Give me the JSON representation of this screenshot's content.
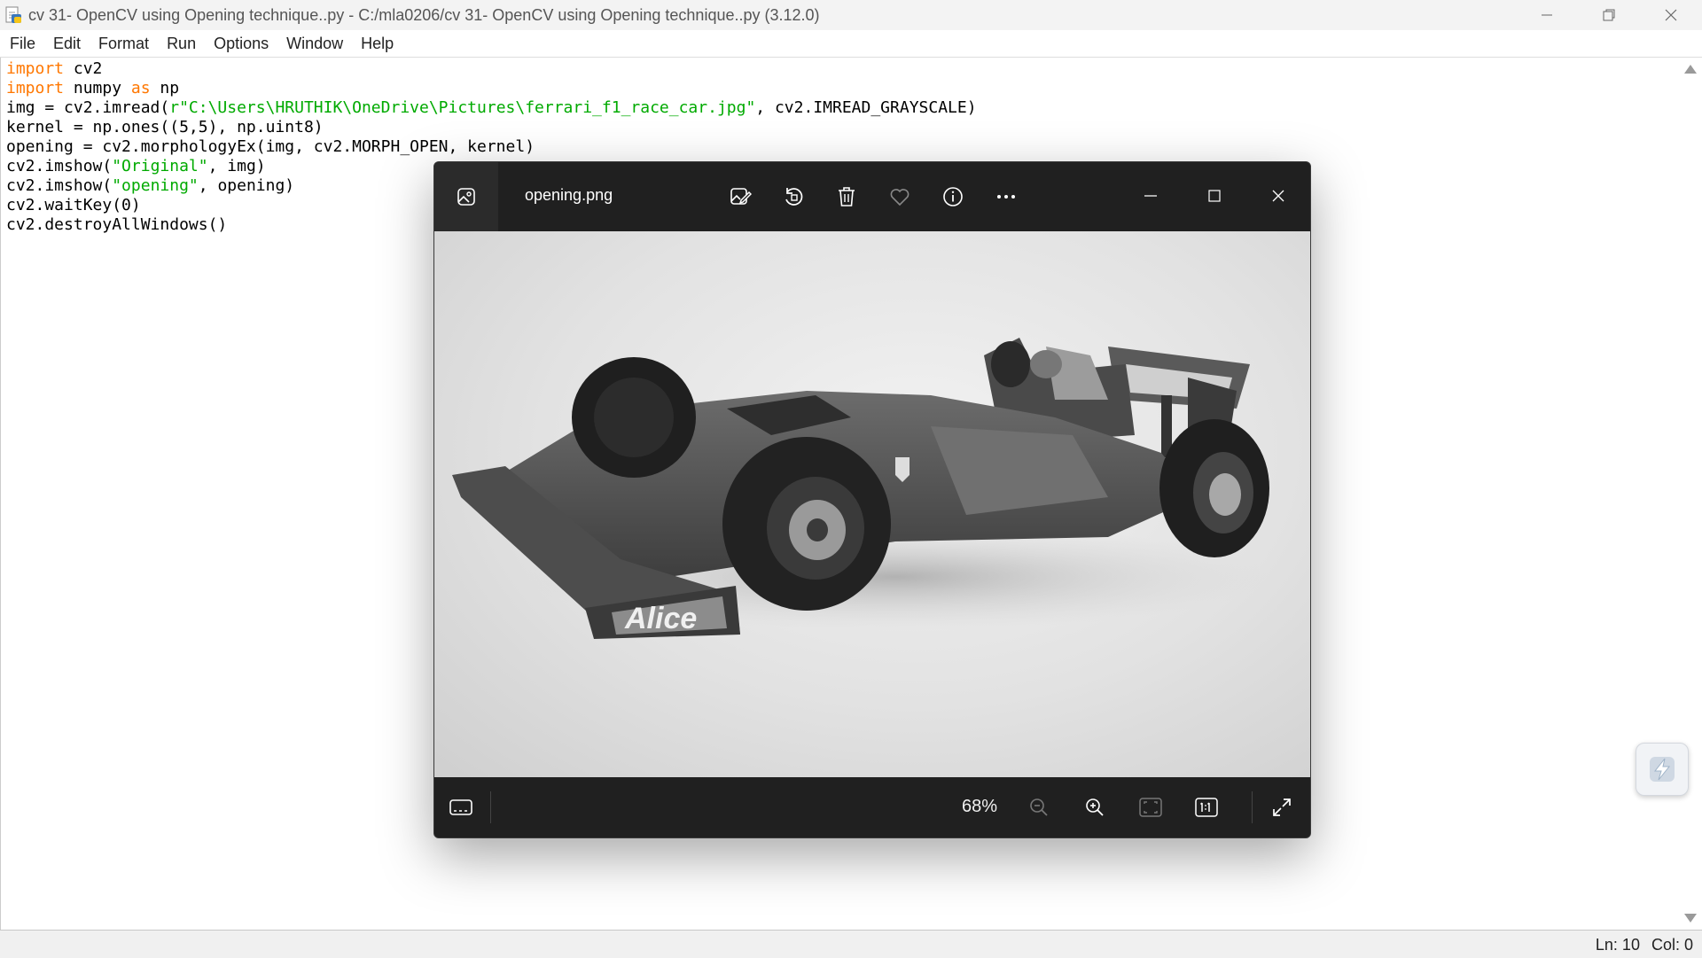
{
  "window": {
    "title": "cv 31- OpenCV using Opening technique..py - C:/mla0206/cv 31- OpenCV using Opening technique..py (3.12.0)"
  },
  "menu": [
    "File",
    "Edit",
    "Format",
    "Run",
    "Options",
    "Window",
    "Help"
  ],
  "code": {
    "l1_kw": "import",
    "l1_rest": " cv2",
    "l2_kw": "import",
    "l2_mid": " numpy ",
    "l2_kw2": "as",
    "l2_rest": " np",
    "l3_pre": "img = cv2.imread(",
    "l3_str": "r\"C:\\Users\\HRUTHIK\\OneDrive\\Pictures\\ferrari_f1_race_car.jpg\"",
    "l3_post": ", cv2.IMREAD_GRAYSCALE)",
    "l4": "kernel = np.ones((5,5), np.uint8)",
    "l5": "opening = cv2.morphologyEx(img, cv2.MORPH_OPEN, kernel)",
    "l6_pre": "cv2.imshow(",
    "l6_str": "\"Original\"",
    "l6_post": ", img)",
    "l7_pre": "cv2.imshow(",
    "l7_str": "\"opening\"",
    "l7_post": ", opening)",
    "l8": "cv2.waitKey(0)",
    "l9": "cv2.destroyAllWindows()"
  },
  "status": {
    "line": "Ln: 10",
    "col": "Col: 0"
  },
  "photos": {
    "filename": "opening.png",
    "zoom": "68%",
    "icons": {
      "tab": "image-icon",
      "edit": "edit-image-icon",
      "rotate": "rotate-icon",
      "delete": "delete-icon",
      "favorite": "heart-icon",
      "info": "info-icon",
      "more": "more-icon",
      "filmstrip": "filmstrip-icon",
      "zoom_out": "zoom-out-icon",
      "zoom_in": "zoom-in-icon",
      "fit": "fit-to-window-icon",
      "actual_size": "actual-size-icon",
      "fullscreen": "fullscreen-icon"
    },
    "image_text": {
      "wing_logo": "Alice"
    }
  },
  "colors": {
    "keyword": "#ff7700",
    "string": "#00aa00",
    "photos_bg": "#202020"
  }
}
